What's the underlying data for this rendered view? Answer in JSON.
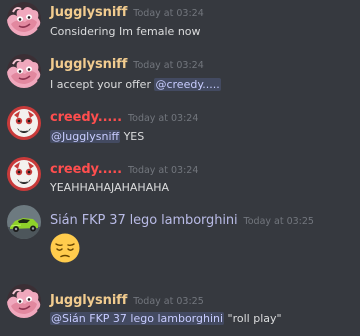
{
  "colors": {
    "background": "#36393f",
    "jugglysniff_name": "#f2cc8f",
    "creedy_name": "#ff4e4e",
    "sian_name": "#b9bbe6",
    "timestamp": "#72767d",
    "text": "#dcddde",
    "mention_text": "#c8ccff"
  },
  "messages": [
    {
      "username": "Jugglysniff",
      "timestamp": "Today at 03:24",
      "avatar_icon": "pink-creature-avatar-icon",
      "text": "Considering Im female now"
    },
    {
      "username": "Jugglysniff",
      "timestamp": "Today at 03:24",
      "avatar_icon": "pink-creature-avatar-icon",
      "text_before": "I accept your offer ",
      "mention": "@creedy....."
    },
    {
      "username": "creedy.....",
      "timestamp": "Today at 03:24",
      "avatar_icon": "red-white-mask-avatar-icon",
      "mention": "@Jugglysniff",
      "text_after": " YES"
    },
    {
      "username": "creedy.....",
      "timestamp": "Today at 03:24",
      "avatar_icon": "red-white-mask-avatar-icon",
      "text": "YEAHHAHAJAHAHAHA"
    },
    {
      "username": "Sián FKP 37 lego lamborghini",
      "timestamp": "Today at 03:25",
      "avatar_icon": "green-lamborghini-avatar-icon",
      "emoji": "pensive-face-emoji"
    },
    {
      "username": "Jugglysniff",
      "timestamp": "Today at 03:25",
      "avatar_icon": "pink-creature-avatar-icon",
      "mention": "@Sián FKP 37 lego lamborghini",
      "text_after": " \"roll play\""
    }
  ]
}
